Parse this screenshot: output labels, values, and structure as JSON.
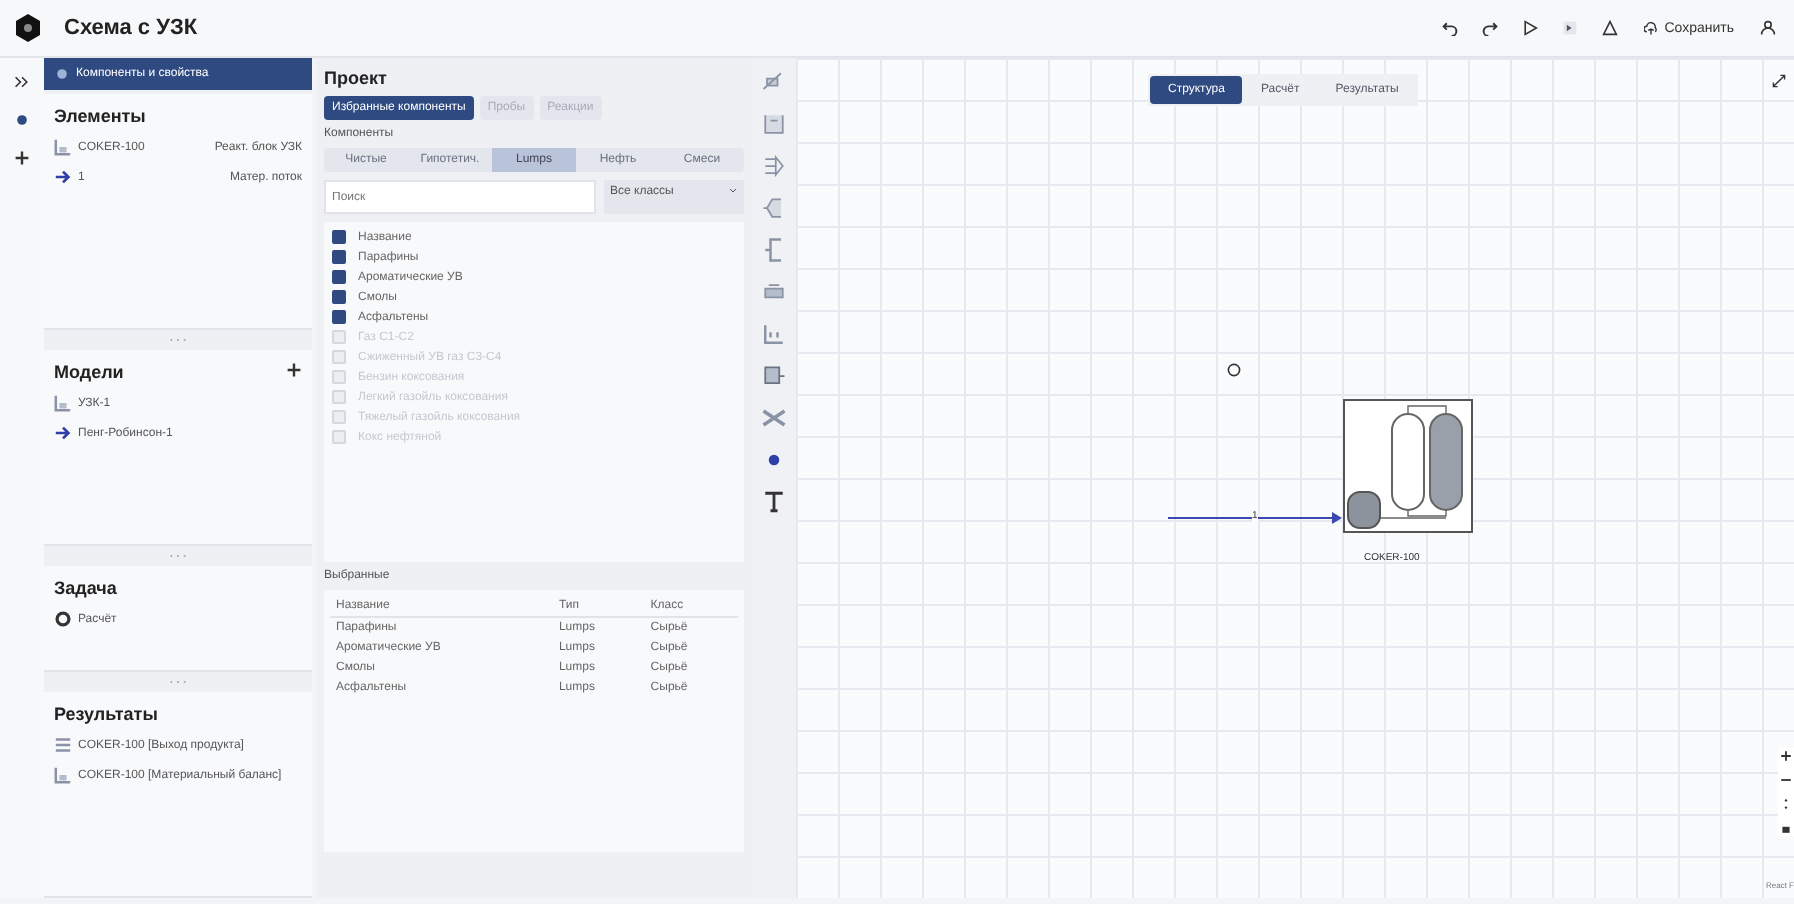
{
  "window": {
    "title": "Схема с УЗК"
  },
  "toolbar": {
    "save": "Сохранить"
  },
  "left_panel": {
    "header": "Компоненты и свойства",
    "elements": {
      "title": "Элементы",
      "items": [
        {
          "kind": "unit",
          "name": "COKER-100",
          "type": "Реакт. блок УЗК"
        },
        {
          "kind": "stream",
          "name": "1",
          "type": "Матер. поток"
        }
      ]
    },
    "models": {
      "title": "Модели",
      "items": [
        {
          "kind": "unit",
          "name": "УЗК-1"
        },
        {
          "kind": "stream",
          "name": "Пенг-Робинсон-1"
        }
      ]
    },
    "task": {
      "title": "Задача",
      "items": [
        {
          "kind": "task",
          "name": "Расчёт"
        }
      ]
    },
    "results": {
      "title": "Результаты",
      "items": [
        {
          "kind": "table",
          "name": "COKER-100 [Выход продукта]"
        },
        {
          "kind": "unit",
          "name": "COKER-100 [Материальный баланс]"
        }
      ]
    }
  },
  "project": {
    "title": "Проект",
    "tabs": [
      {
        "label": "Избранные компоненты",
        "selected": true
      },
      {
        "label": "Пробы",
        "selected": false
      },
      {
        "label": "Реакции",
        "selected": false
      }
    ],
    "components_label": "Компоненты",
    "subtabs": [
      {
        "label": "Чистые",
        "selected": false
      },
      {
        "label": "Гипотетич.",
        "selected": false
      },
      {
        "label": "Lumps",
        "selected": true
      },
      {
        "label": "Нефть",
        "selected": false
      },
      {
        "label": "Смеси",
        "selected": false
      }
    ],
    "search": {
      "placeholder": "Поиск"
    },
    "class_filter": "Все классы",
    "list": [
      {
        "label": "Название",
        "checked": true,
        "disabled": false
      },
      {
        "label": "Парафины",
        "checked": true,
        "disabled": false
      },
      {
        "label": "Ароматические УВ",
        "checked": true,
        "disabled": false
      },
      {
        "label": "Смолы",
        "checked": true,
        "disabled": false
      },
      {
        "label": "Асфальтены",
        "checked": true,
        "disabled": false
      },
      {
        "label": "Газ С1-С2",
        "checked": false,
        "disabled": true
      },
      {
        "label": "Сжиженный УВ газ С3-С4",
        "checked": false,
        "disabled": true
      },
      {
        "label": "Бензин коксования",
        "checked": false,
        "disabled": true
      },
      {
        "label": "Легкий газойль коксования",
        "checked": false,
        "disabled": true
      },
      {
        "label": "Тяжелый газойль коксования",
        "checked": false,
        "disabled": true
      },
      {
        "label": "Кокс нефтяной",
        "checked": false,
        "disabled": true
      }
    ],
    "selected_title": "Выбранные",
    "table": {
      "columns": [
        "Название",
        "Тип",
        "Класс"
      ],
      "rows": [
        [
          "Парафины",
          "Lumps",
          "Сырьё"
        ],
        [
          "Ароматические УВ",
          "Lumps",
          "Сырьё"
        ],
        [
          "Смолы",
          "Lumps",
          "Сырьё"
        ],
        [
          "Асфальтены",
          "Lumps",
          "Сырьё"
        ]
      ]
    }
  },
  "canvas": {
    "tabs": [
      {
        "label": "Структура",
        "selected": true
      },
      {
        "label": "Расчёт",
        "selected": false
      },
      {
        "label": "Результаты",
        "selected": false
      }
    ],
    "stream_label": "1",
    "unit_label": "COKER-100",
    "attribution": "React F"
  }
}
